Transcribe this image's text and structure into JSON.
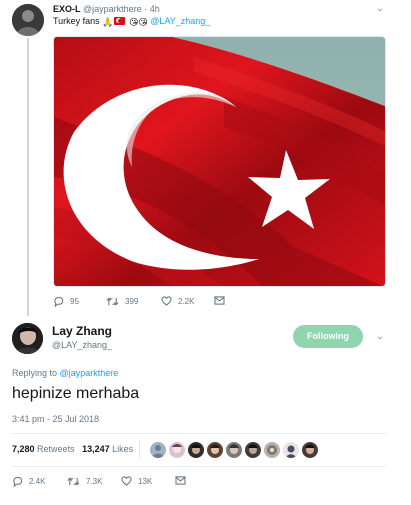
{
  "parent_tweet": {
    "name": "EXO-L",
    "handle": "@jayparkthere",
    "separator": "·",
    "time": "4h",
    "text": "Turkey fans",
    "emoji": [
      "🙏",
      "😘",
      "😘"
    ],
    "mention": "@LAY_zhang_",
    "replies": "95",
    "retweets": "399",
    "likes": "2.2K"
  },
  "main_tweet": {
    "name": "Lay Zhang",
    "handle": "@LAY_zhang_",
    "follow_label": "Following",
    "replying_prefix": "Replying to",
    "replying_to": "@jayparkthere",
    "text": "hepinize merhaba",
    "timestamp": "3:41 pm - 25 Jul 2018",
    "retweet_count": "7,280",
    "retweet_label": "Retweets",
    "like_count": "13,247",
    "like_label": "Likes",
    "replies": "2.4K",
    "retweets": "7.3K",
    "likes": "13K"
  },
  "icons": {
    "caret": "chevron-down-icon",
    "reply": "reply-icon",
    "retweet": "retweet-icon",
    "like": "heart-icon",
    "dm": "envelope-icon"
  },
  "colors": {
    "link": "#1da1f2",
    "secondary_text": "#657786",
    "follow_button": "#8fd5b0",
    "flag_red": "#e30a17"
  }
}
